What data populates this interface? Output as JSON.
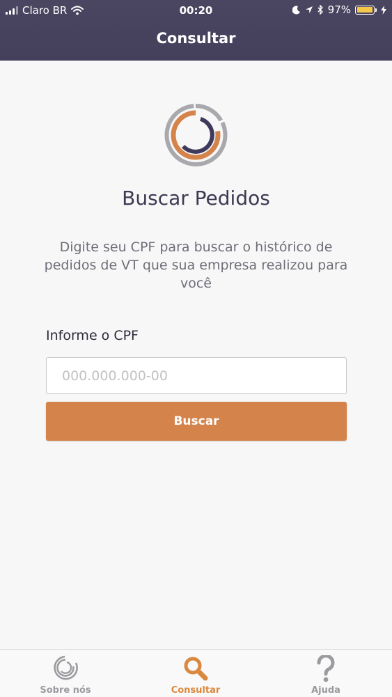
{
  "status_bar": {
    "carrier": "Claro BR",
    "time": "00:20",
    "battery_percent": "97%",
    "battery_level": 0.97
  },
  "nav": {
    "title": "Consultar"
  },
  "main": {
    "title": "Buscar Pedidos",
    "description": "Digite seu CPF para buscar o histórico de pedidos de VT que sua empresa realizou para você",
    "cpf_label": "Informe o CPF",
    "cpf_placeholder": "000.000.000-00",
    "cpf_value": "",
    "search_button_label": "Buscar"
  },
  "tab_bar": {
    "items": [
      {
        "label": "Sobre nós",
        "icon": "logo-icon",
        "active": false
      },
      {
        "label": "Consultar",
        "icon": "search-icon",
        "active": true
      },
      {
        "label": "Ajuda",
        "icon": "question-icon",
        "active": false
      }
    ]
  },
  "colors": {
    "header": "#46425e",
    "accent": "#d4834a",
    "title": "#3b3a52",
    "inactive_tab": "#9b9b9f"
  }
}
